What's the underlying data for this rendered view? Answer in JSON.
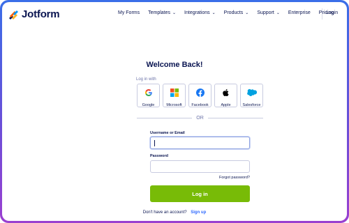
{
  "brand": {
    "name": "Jotform"
  },
  "nav": {
    "items": [
      {
        "label": "My Forms",
        "dropdown": false
      },
      {
        "label": "Templates",
        "dropdown": true
      },
      {
        "label": "Integrations",
        "dropdown": true
      },
      {
        "label": "Products",
        "dropdown": true
      },
      {
        "label": "Support",
        "dropdown": true
      },
      {
        "label": "Enterprise",
        "dropdown": false
      },
      {
        "label": "Pricing",
        "dropdown": false
      }
    ],
    "login": "Login"
  },
  "page": {
    "title": "Welcome Back!",
    "login_with": "Log in with",
    "providers": [
      {
        "label": "Google",
        "icon": "google-icon"
      },
      {
        "label": "Microsoft",
        "icon": "microsoft-icon"
      },
      {
        "label": "Facebook",
        "icon": "facebook-icon"
      },
      {
        "label": "Apple",
        "icon": "apple-icon"
      },
      {
        "label": "Salesforce",
        "icon": "salesforce-icon"
      }
    ],
    "or": "OR",
    "username_label": "Username or Email",
    "username_value": "",
    "password_label": "Password",
    "password_value": "",
    "forgot": "Forgot password?",
    "login_button": "Log in",
    "no_account": "Don't have an account?",
    "signup": "Sign up"
  },
  "colors": {
    "primary": "#0a1551",
    "button": "#78bb07",
    "link": "#2e69ff",
    "frame_top": "#3a6ee8",
    "frame_bottom": "#9a3fd0"
  }
}
